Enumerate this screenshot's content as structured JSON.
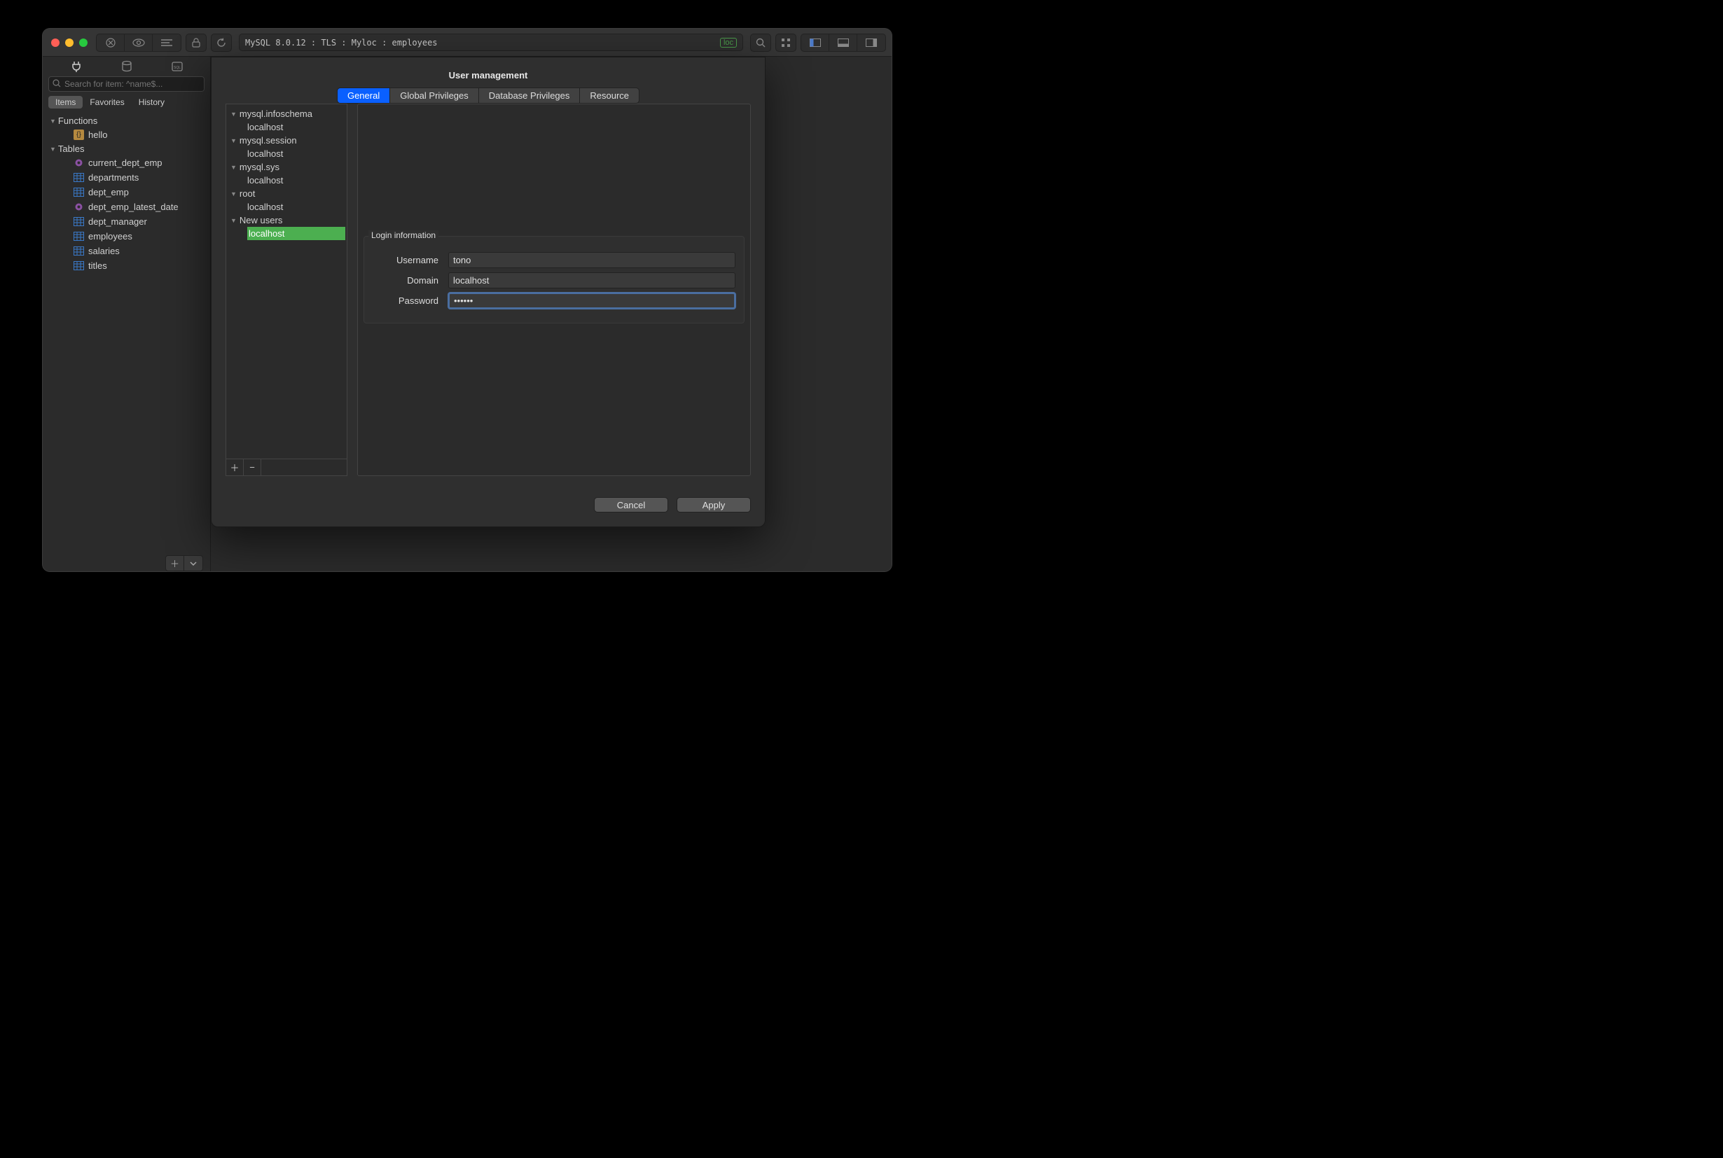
{
  "titlebar": {
    "path": "MySQL 8.0.12 : TLS : Myloc : employees",
    "loc_badge": "loc"
  },
  "sidebar": {
    "search_placeholder": "Search for item: ^name$...",
    "filters": {
      "items": "Items",
      "favorites": "Favorites",
      "history": "History"
    },
    "functions_header": "Functions",
    "func_item": "hello",
    "tables_header": "Tables",
    "tables": [
      {
        "name": "current_dept_emp",
        "type": "view"
      },
      {
        "name": "departments",
        "type": "table"
      },
      {
        "name": "dept_emp",
        "type": "table"
      },
      {
        "name": "dept_emp_latest_date",
        "type": "view"
      },
      {
        "name": "dept_manager",
        "type": "table"
      },
      {
        "name": "employees",
        "type": "table"
      },
      {
        "name": "salaries",
        "type": "table"
      },
      {
        "name": "titles",
        "type": "table"
      }
    ]
  },
  "modal": {
    "title": "User management",
    "tabs": {
      "general": "General",
      "global": "Global Privileges",
      "db": "Database Privileges",
      "resource": "Resource"
    },
    "users": [
      {
        "name": "mysql.infoschema",
        "hosts": [
          "localhost"
        ]
      },
      {
        "name": "mysql.session",
        "hosts": [
          "localhost"
        ]
      },
      {
        "name": "mysql.sys",
        "hosts": [
          "localhost"
        ]
      },
      {
        "name": "root",
        "hosts": [
          "localhost"
        ]
      },
      {
        "name": "New users",
        "hosts": [
          "localhost"
        ],
        "selected": true
      }
    ],
    "form": {
      "legend": "Login information",
      "username_label": "Username",
      "username_value": "tono",
      "domain_label": "Domain",
      "domain_value": "localhost",
      "password_label": "Password",
      "password_value": "••••••"
    },
    "buttons": {
      "cancel": "Cancel",
      "apply": "Apply"
    }
  }
}
